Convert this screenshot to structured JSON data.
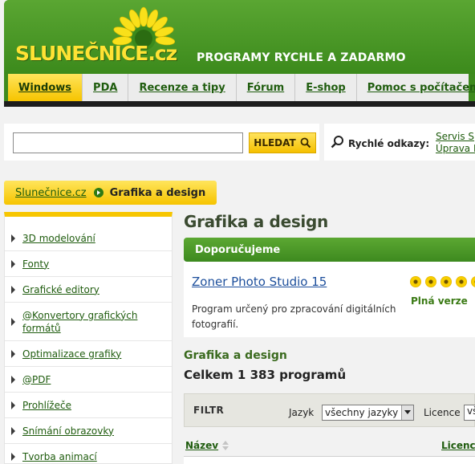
{
  "header": {
    "logo": "SLUNEČNICE.cz",
    "tagline": "PROGRAMY RYCHLE A ZADARMO",
    "nav": [
      {
        "label": "Windows",
        "active": true
      },
      {
        "label": "PDA"
      },
      {
        "label": "Recenze a tipy"
      },
      {
        "label": "Fórum"
      },
      {
        "label": "E-shop"
      },
      {
        "label": "Pomoc s počítačem"
      }
    ]
  },
  "search": {
    "value": "",
    "button_label": "HLEDAT",
    "button_icon": "magnifier-icon"
  },
  "quick_links": {
    "label": "Rychlé odkazy:",
    "icon": "magnifier-icon",
    "links": [
      "Servis S",
      "Úprava F"
    ]
  },
  "breadcrumb": {
    "home": "Slunečnice.cz",
    "current": "Grafika a design"
  },
  "sidebar": {
    "categories": [
      "3D modelování",
      "Fonty",
      "Grafické editory",
      "@Konvertory grafických formátů",
      "Optimalizace grafiky",
      "@PDF",
      "Prohlížeče",
      "Snímání obrazovky",
      "Tvorba animací"
    ]
  },
  "main": {
    "title": "Grafika a design",
    "recommend_label": "Doporučujeme",
    "product": {
      "title": "Zoner Photo Studio 15",
      "description": "Program určený pro zpracování digitálních fotografií.",
      "rating_stars": 5,
      "license": "Plná verze"
    },
    "section_title": "Grafika a design",
    "count_text": "Celkem 1 383 programů",
    "filter": {
      "title": "FILTR",
      "language_label": "Jazyk",
      "language_value": "všechny jazyky",
      "license_label": "Licence",
      "license_value": "vš"
    },
    "table": {
      "col_name": "Název",
      "col_license": "Licenc"
    }
  },
  "colors": {
    "brand_green": "#3e8a1e",
    "accent_yellow": "#f6c400",
    "link_green": "#1f5c0e",
    "product_link_blue": "#1d4f9c"
  }
}
